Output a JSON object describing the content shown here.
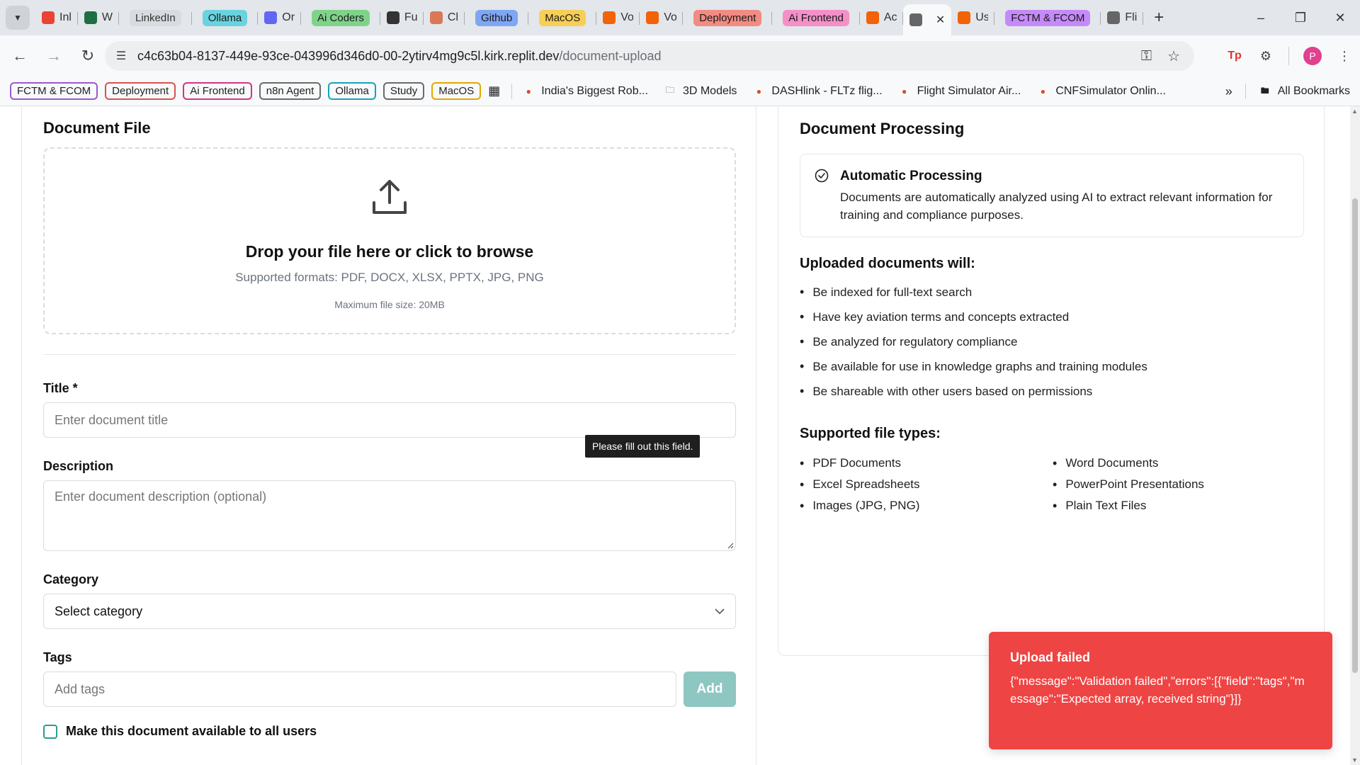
{
  "browser": {
    "tabs": [
      {
        "title": "Inl",
        "favicon": "gmail-icon",
        "color": "#EA4335"
      },
      {
        "title": "W",
        "favicon": "excel-icon",
        "color": "#1D6F42"
      },
      {
        "title": "LinkedIn",
        "group": true,
        "chip_bg": "#d8dbe0",
        "chip_fg": "#333333"
      },
      {
        "title": "Ollama",
        "group": true,
        "chip_bg": "#69d3df",
        "chip_fg": "#1a1a1a"
      },
      {
        "title": "Or",
        "favicon": "openrouter-icon",
        "color": "#6366f1"
      },
      {
        "title": "Ai Coders",
        "group": true,
        "chip_bg": "#7fd389",
        "chip_fg": "#1a1a1a"
      },
      {
        "title": "Fu",
        "favicon": "openai-icon",
        "color": "#333333"
      },
      {
        "title": "Cl",
        "favicon": "claude-icon",
        "color": "#d97757"
      },
      {
        "title": "Github",
        "group": true,
        "chip_bg": "#7fa6f2",
        "chip_fg": "#1a1a1a"
      },
      {
        "title": "MacOS",
        "group": true,
        "chip_bg": "#f7cf56",
        "chip_fg": "#1a1a1a"
      },
      {
        "title": "Vo",
        "favicon": "replit-icon",
        "color": "#f26207"
      },
      {
        "title": "Vo",
        "favicon": "replit-icon",
        "color": "#f26207"
      },
      {
        "title": "Deployment",
        "group": true,
        "chip_bg": "#f28b82",
        "chip_fg": "#1a1a1a"
      },
      {
        "title": "Ai Frontend",
        "group": true,
        "chip_bg": "#f48fc7",
        "chip_fg": "#1a1a1a"
      },
      {
        "title": "Ac",
        "favicon": "replit-icon",
        "color": "#f26207"
      },
      {
        "title": "",
        "favicon": "globe-icon",
        "color": "#666666",
        "active": true
      },
      {
        "title": "Us",
        "favicon": "replit-icon",
        "color": "#f26207"
      },
      {
        "title": "FCTM & FCOM",
        "group": true,
        "chip_bg": "#c58af9",
        "chip_fg": "#1a1a1a"
      },
      {
        "title": "Fli",
        "favicon": "globe-icon",
        "color": "#666666"
      }
    ],
    "url_host": "c4c63b04-8137-449e-93ce-043996d346d0-00-2ytirv4mg9c5l.kirk.replit.dev",
    "url_path": "/document-upload",
    "avatar_letter": "P",
    "bookmark_chips": [
      {
        "label": "FCTM & FCOM",
        "color": "#9b59d0"
      },
      {
        "label": "Deployment",
        "color": "#d9534f"
      },
      {
        "label": "Ai Frontend",
        "color": "#d63384"
      },
      {
        "label": "n8n Agent",
        "color": "#6b6b6b"
      },
      {
        "label": "Ollama",
        "color": "#17a2b8"
      },
      {
        "label": "Study",
        "color": "#6b6b6b"
      },
      {
        "label": "MacOS",
        "color": "#e0a800"
      }
    ],
    "bookmarks": [
      {
        "label": "India's Biggest Rob...",
        "icon": "robot-site-icon"
      },
      {
        "label": "3D Models",
        "icon": "folder-icon"
      },
      {
        "label": "DASHlink - FLTz flig...",
        "icon": "nasa-icon"
      },
      {
        "label": "Flight Simulator Air...",
        "icon": "plane-icon"
      },
      {
        "label": "CNFSimulator Onlin...",
        "icon": "simulator-icon"
      }
    ],
    "all_bookmarks": "All Bookmarks"
  },
  "upload_form": {
    "heading": "Document File",
    "dropzone_title": "Drop your file here or click to browse",
    "dropzone_formats": "Supported formats: PDF, DOCX, XLSX, PPTX, JPG, PNG",
    "dropzone_max": "Maximum file size: 20MB",
    "title_label": "Title *",
    "title_placeholder": "Enter document title",
    "tooltip": "Please fill out this field.",
    "description_label": "Description",
    "description_placeholder": "Enter document description (optional)",
    "category_label": "Category",
    "category_value": "Select category",
    "tags_label": "Tags",
    "tags_placeholder": "Add tags",
    "add_button": "Add",
    "public_checkbox": "Make this document available to all users"
  },
  "processing": {
    "heading": "Document Processing",
    "auto_title": "Automatic Processing",
    "auto_desc": "Documents are automatically analyzed using AI to extract relevant information for training and compliance purposes.",
    "uploaded_heading": "Uploaded documents will:",
    "uploaded_items": [
      "Be indexed for full-text search",
      "Have key aviation terms and concepts extracted",
      "Be analyzed for regulatory compliance",
      "Be available for use in knowledge graphs and training modules",
      "Be shareable with other users based on permissions"
    ],
    "filetypes_heading": "Supported file types:",
    "filetypes_left": [
      "PDF Documents",
      "Excel Spreadsheets",
      "Images (JPG, PNG)"
    ],
    "filetypes_right": [
      "Word Documents",
      "PowerPoint Presentations",
      "Plain Text Files"
    ]
  },
  "toast": {
    "title": "Upload failed",
    "message": "{\"message\":\"Validation failed\",\"errors\":[{\"field\":\"tags\",\"message\":\"Expected array, received string\"}]}"
  }
}
